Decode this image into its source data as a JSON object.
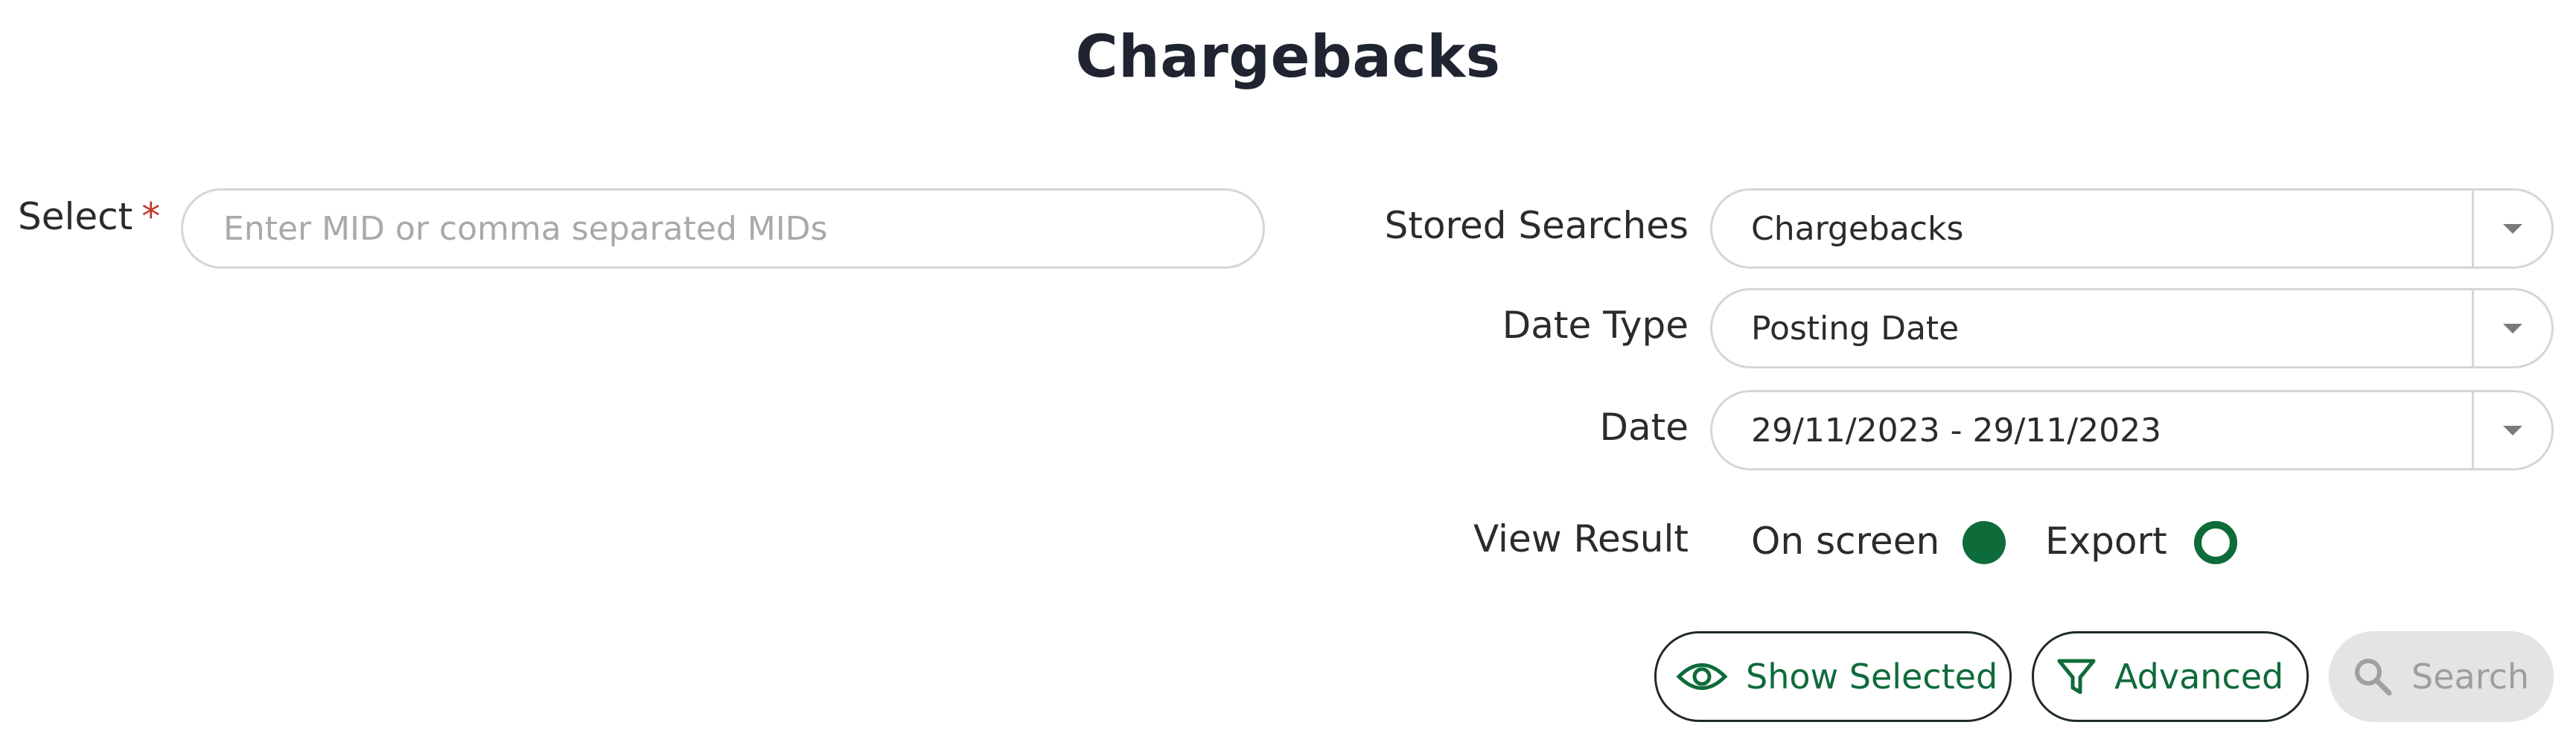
{
  "page": {
    "title": "Chargebacks"
  },
  "select": {
    "label": "Select",
    "required_mark": "*",
    "placeholder": "Enter MID or comma separated MIDs",
    "value": ""
  },
  "stored_searches": {
    "label": "Stored Searches",
    "value": "Chargebacks"
  },
  "date_type": {
    "label": "Date Type",
    "value": "Posting Date"
  },
  "date": {
    "label": "Date",
    "value": "29/11/2023 - 29/11/2023"
  },
  "view_result": {
    "label": "View Result",
    "options": [
      {
        "label": "On screen",
        "selected": true
      },
      {
        "label": "Export",
        "selected": false
      }
    ]
  },
  "buttons": {
    "show_selected": {
      "label": "Show Selected",
      "icon": "eye-icon"
    },
    "advanced": {
      "label": "Advanced",
      "icon": "filter-icon"
    },
    "search": {
      "label": "Search",
      "icon": "search-icon",
      "disabled": true
    }
  },
  "colors": {
    "accent": "#0e6b3a",
    "required": "#c0392b",
    "border": "#d6d6d6",
    "disabled_bg": "#e4e4e4"
  }
}
